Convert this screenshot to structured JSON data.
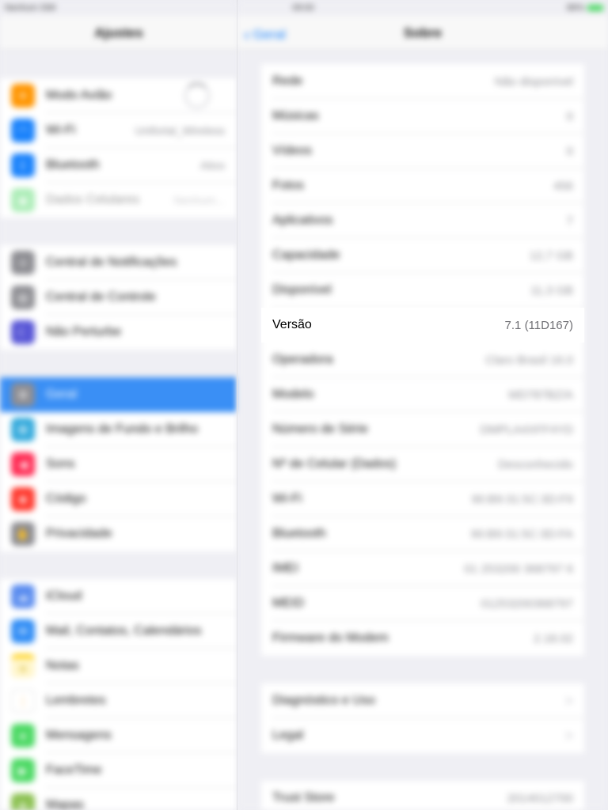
{
  "status_bar": {
    "carrier": "Nenhum SIM",
    "time": "09:00",
    "battery": "86%"
  },
  "sidebar": {
    "title": "Ajustes",
    "groups": [
      [
        {
          "label": "Modo Avião",
          "value": "",
          "icon": "airplane-icon",
          "color": "#ff9500"
        },
        {
          "label": "Wi-Fi",
          "value": "Unifortal_Wireless",
          "icon": "wifi-icon",
          "color": "#1a82fb"
        },
        {
          "label": "Bluetooth",
          "value": "Ativo",
          "icon": "bluetooth-icon",
          "color": "#1a82fb"
        },
        {
          "label": "Dados Celulares",
          "value": "Nenhum...",
          "icon": "cellular-icon",
          "color": "#4cd964",
          "dim": true
        }
      ],
      [
        {
          "label": "Central de Notificações",
          "value": "",
          "icon": "notifications-icon",
          "color": "#8e8e93"
        },
        {
          "label": "Central de Controle",
          "value": "",
          "icon": "control-center-icon",
          "color": "#8e8e93"
        },
        {
          "label": "Não Perturbe",
          "value": "",
          "icon": "moon-icon",
          "color": "#5856d6"
        }
      ],
      [
        {
          "label": "Geral",
          "value": "",
          "icon": "gear-icon",
          "color": "#8e8e93",
          "selected": true
        },
        {
          "label": "Imagens de Fundo e Brilho",
          "value": "",
          "icon": "wallpaper-icon",
          "color": "#34aadc"
        },
        {
          "label": "Sons",
          "value": "",
          "icon": "speaker-icon",
          "color": "#ff2d55"
        },
        {
          "label": "Código",
          "value": "",
          "icon": "lock-icon",
          "color": "#ff3b30"
        },
        {
          "label": "Privacidade",
          "value": "",
          "icon": "hand-icon",
          "color": "#8e8e93"
        }
      ],
      [
        {
          "label": "iCloud",
          "value": "",
          "icon": "cloud-icon",
          "color": "#5b8def"
        },
        {
          "label": "Mail, Contatos, Calendários",
          "value": "",
          "icon": "mail-icon",
          "color": "#2f8cf5"
        },
        {
          "label": "Notas",
          "value": "",
          "icon": "notes-icon",
          "color": "#ffcc00"
        },
        {
          "label": "Lembretes",
          "value": "",
          "icon": "reminders-icon",
          "color": "#ffffff"
        },
        {
          "label": "Mensagens",
          "value": "",
          "icon": "messages-icon",
          "color": "#4cd964"
        },
        {
          "label": "FaceTime",
          "value": "",
          "icon": "facetime-icon",
          "color": "#4cd964"
        },
        {
          "label": "Mapas",
          "value": "",
          "icon": "maps-icon",
          "color": "#8cc152"
        }
      ]
    ]
  },
  "detail": {
    "back_label": "Geral",
    "title": "Sobre",
    "group1": [
      {
        "label": "Rede",
        "value": "Não disponível"
      },
      {
        "label": "Músicas",
        "value": "0"
      },
      {
        "label": "Vídeos",
        "value": "0"
      },
      {
        "label": "Fotos",
        "value": "456"
      },
      {
        "label": "Aplicativos",
        "value": "7"
      },
      {
        "label": "Capacidade",
        "value": "12,7 GB"
      },
      {
        "label": "Disponível",
        "value": "11,3 GB"
      },
      {
        "label": "Versão",
        "value": "7.1 (11D167)"
      },
      {
        "label": "Operadora",
        "value": "Claro Brasil 16.0"
      },
      {
        "label": "Modelo",
        "value": "MD787BZ/A"
      },
      {
        "label": "Número de Série",
        "value": "DMPLA4XFF4YD"
      },
      {
        "label": "Nº de Celular (Dados)",
        "value": "Desconhecido"
      },
      {
        "label": "Wi-Fi",
        "value": "90:B9:31:5C:3D:F9"
      },
      {
        "label": "Bluetooth",
        "value": "90:B9:31:5C:3D:FA"
      },
      {
        "label": "IMEI",
        "value": "01 253200 368797 6"
      },
      {
        "label": "MEID",
        "value": "01253200368797"
      },
      {
        "label": "Firmware do Modem",
        "value": "2.18.02"
      }
    ],
    "group2": [
      {
        "label": "Diagnóstico e Uso",
        "value": ">"
      },
      {
        "label": "Legal",
        "value": ">"
      }
    ],
    "group3": [
      {
        "label": "Trust Store",
        "value": "2014012700"
      }
    ]
  }
}
